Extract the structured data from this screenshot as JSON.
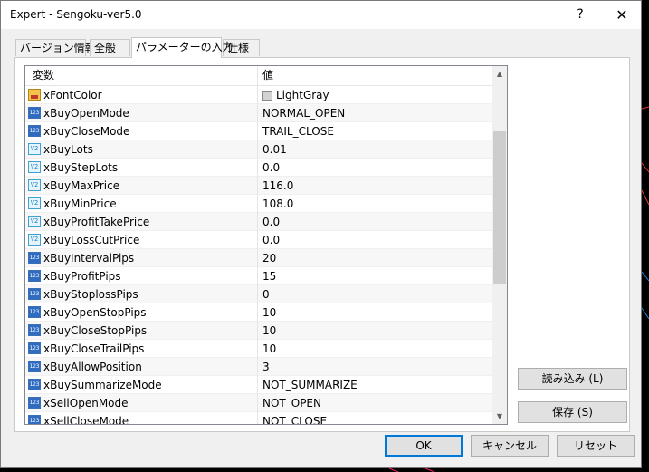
{
  "window": {
    "title": "Expert - Sengoku-ver5.0",
    "help": "?",
    "close": "✕"
  },
  "tabs": [
    {
      "label": "バージョン情報"
    },
    {
      "label": "全般"
    },
    {
      "label": "パラメーターの入力"
    },
    {
      "label": "仕様"
    }
  ],
  "grid": {
    "header_variable": "変数",
    "header_value": "値",
    "rows": [
      {
        "type": "color",
        "name": "xFontColor",
        "value": "LightGray"
      },
      {
        "type": "int",
        "name": "xBuyOpenMode",
        "value": "NORMAL_OPEN"
      },
      {
        "type": "int",
        "name": "xBuyCloseMode",
        "value": "TRAIL_CLOSE"
      },
      {
        "type": "double",
        "name": "xBuyLots",
        "value": "0.01"
      },
      {
        "type": "double",
        "name": "xBuyStepLots",
        "value": "0.0"
      },
      {
        "type": "double",
        "name": "xBuyMaxPrice",
        "value": "116.0"
      },
      {
        "type": "double",
        "name": "xBuyMinPrice",
        "value": "108.0"
      },
      {
        "type": "double",
        "name": "xBuyProfitTakePrice",
        "value": "0.0"
      },
      {
        "type": "double",
        "name": "xBuyLossCutPrice",
        "value": "0.0"
      },
      {
        "type": "int",
        "name": "xBuyIntervalPips",
        "value": "20"
      },
      {
        "type": "int",
        "name": "xBuyProfitPips",
        "value": "15"
      },
      {
        "type": "int",
        "name": "xBuyStoplossPips",
        "value": "0"
      },
      {
        "type": "int",
        "name": "xBuyOpenStopPips",
        "value": "10"
      },
      {
        "type": "int",
        "name": "xBuyCloseStopPips",
        "value": "10"
      },
      {
        "type": "int",
        "name": "xBuyCloseTrailPips",
        "value": "10"
      },
      {
        "type": "int",
        "name": "xBuyAllowPosition",
        "value": "3"
      },
      {
        "type": "int",
        "name": "xBuySummarizeMode",
        "value": "NOT_SUMMARIZE"
      },
      {
        "type": "int",
        "name": "xSellOpenMode",
        "value": "NOT_OPEN"
      },
      {
        "type": "int",
        "name": "xSellCloseMode",
        "value": "NOT_CLOSE"
      }
    ],
    "icon_labels": {
      "int": "123",
      "double": "V2",
      "color": ""
    }
  },
  "buttons": {
    "load": "読み込み (L)",
    "save": "保存 (S)",
    "ok": "OK",
    "cancel": "キャンセル",
    "reset": "リセット"
  },
  "colors": {
    "accent": "#0078d7",
    "swatch": "#d3d3d3"
  }
}
